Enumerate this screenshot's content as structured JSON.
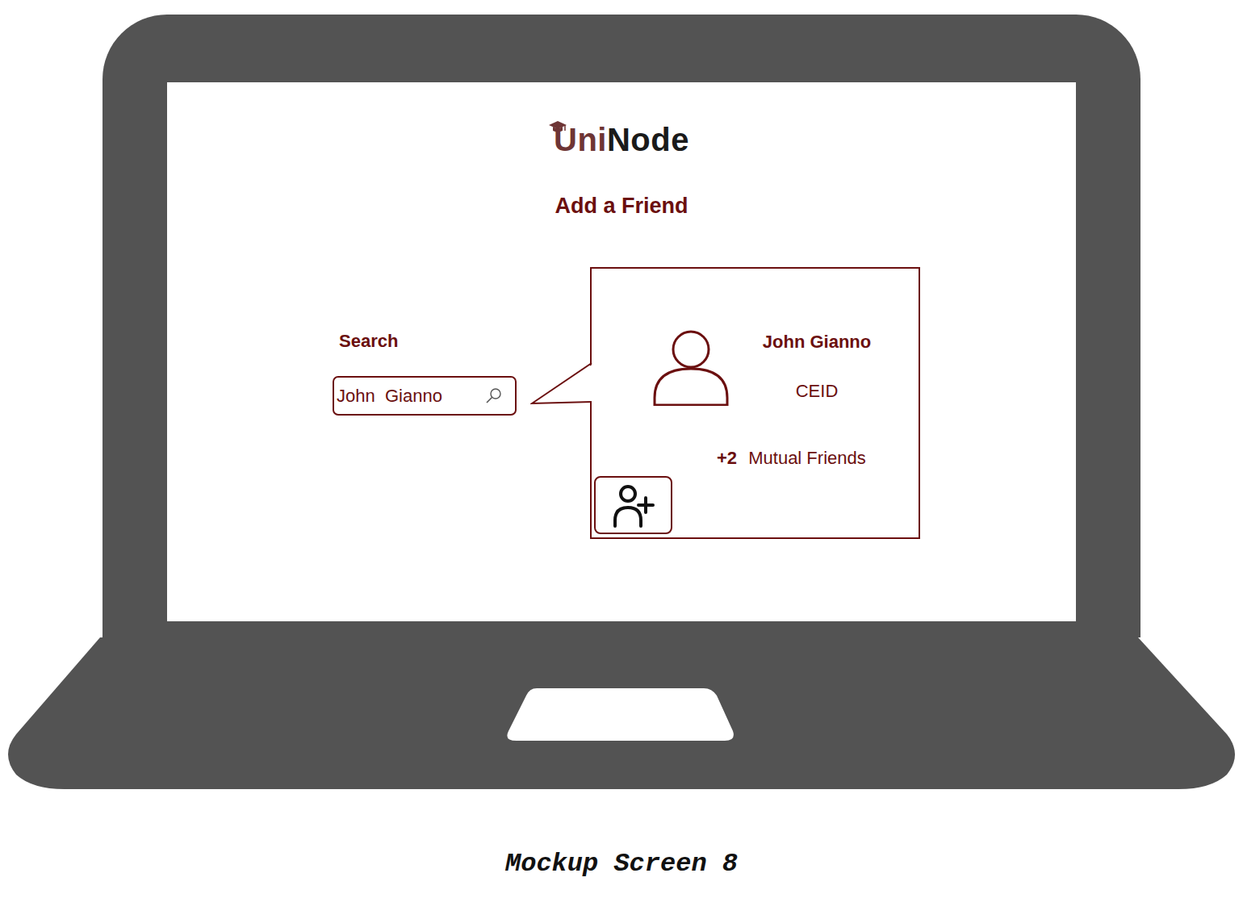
{
  "logo": {
    "prefix": "Uni",
    "suffix": "Node"
  },
  "page": {
    "title": "Add a Friend"
  },
  "search": {
    "label": "Search",
    "value": "John  Gianno"
  },
  "result": {
    "name": "John Gianno",
    "department": "CEID",
    "mutual_count": "+2",
    "mutual_label": "Mutual Friends"
  },
  "caption": "Mockup Screen 8"
}
